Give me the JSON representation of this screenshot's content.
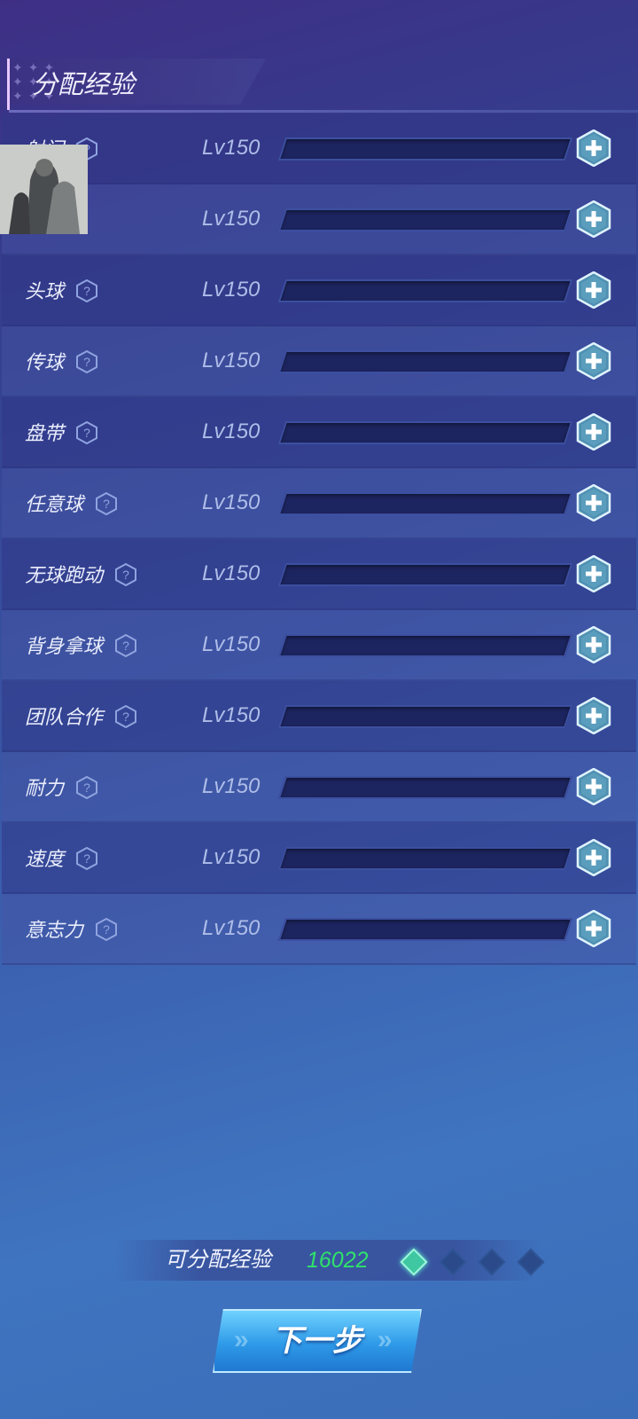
{
  "header": {
    "title": "分配经验"
  },
  "attributes": [
    {
      "name": "射门",
      "level": "Lv150",
      "progress": 0
    },
    {
      "name": "",
      "level": "Lv150",
      "progress": 0
    },
    {
      "name": "头球",
      "level": "Lv150",
      "progress": 0
    },
    {
      "name": "传球",
      "level": "Lv150",
      "progress": 0
    },
    {
      "name": "盘带",
      "level": "Lv150",
      "progress": 0
    },
    {
      "name": "任意球",
      "level": "Lv150",
      "progress": 0
    },
    {
      "name": "无球跑动",
      "level": "Lv150",
      "progress": 0
    },
    {
      "name": "背身拿球",
      "level": "Lv150",
      "progress": 0
    },
    {
      "name": "团队合作",
      "level": "Lv150",
      "progress": 0
    },
    {
      "name": "耐力",
      "level": "Lv150",
      "progress": 0
    },
    {
      "name": "速度",
      "level": "Lv150",
      "progress": 0
    },
    {
      "name": "意志力",
      "level": "Lv150",
      "progress": 0
    }
  ],
  "footer": {
    "exp_label": "可分配经验",
    "exp_value": "16022",
    "exp_diamonds_active": 1,
    "exp_diamonds_total": 4,
    "next_button_label": "下一步"
  },
  "icons": {
    "help": "question-hex-icon",
    "plus": "plus-hex-icon",
    "exp": "diamond-icon"
  },
  "colors": {
    "exp_value": "#2fe36b",
    "plus_button": "#4f8fb0"
  }
}
